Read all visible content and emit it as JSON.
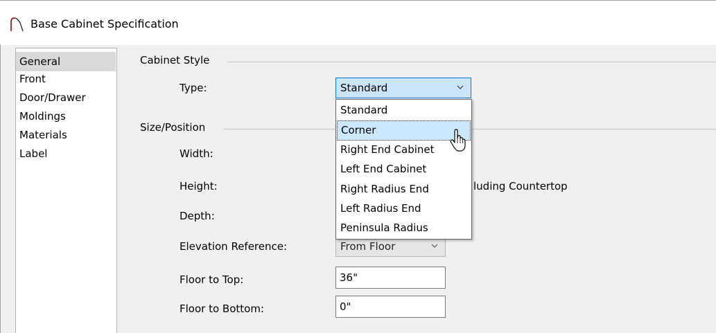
{
  "window": {
    "title": "Base Cabinet Specification",
    "icon": "arch-icon"
  },
  "nav": {
    "items": [
      {
        "label": "General",
        "selected": true
      },
      {
        "label": "Front",
        "selected": false
      },
      {
        "label": "Door/Drawer",
        "selected": false
      },
      {
        "label": "Moldings",
        "selected": false
      },
      {
        "label": "Materials",
        "selected": false
      },
      {
        "label": "Label",
        "selected": false
      }
    ]
  },
  "cabinet_style": {
    "group_label": "Cabinet Style",
    "type_label": "Type:",
    "type_value": "Standard",
    "dropdown_options": [
      "Standard",
      "Corner",
      "Right End Cabinet",
      "Left End Cabinet",
      "Right Radius End",
      "Left Radius End",
      "Peninsula Radius"
    ],
    "highlighted_option": "Corner"
  },
  "size_position": {
    "group_label": "Size/Position",
    "width_label": "Width:",
    "height_label": "Height:",
    "height_note_visible": "luding Countertop",
    "depth_label": "Depth:",
    "elevation_reference_label": "Elevation Reference:",
    "elevation_reference_value": "From Floor",
    "floor_to_top_label": "Floor to Top:",
    "floor_to_top_value": "36\"",
    "floor_to_bottom_label": "Floor to Bottom:",
    "floor_to_bottom_value": "0\""
  },
  "colors": {
    "selected_nav_bg": "#d9d9d9",
    "focus_border": "#0078d7",
    "open_select_bg": "#cce4f7",
    "hover_option_bg": "#cce8ff"
  }
}
